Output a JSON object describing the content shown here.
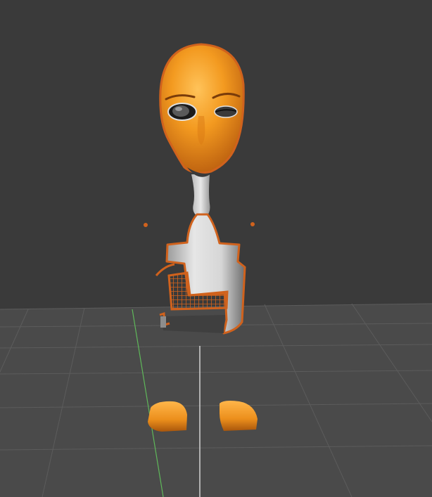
{
  "viewport": {
    "view": "3D viewport",
    "background_color": "#3a3a3a",
    "grid": true,
    "grid_color": "#5a5a5a",
    "axes": {
      "y_axis_color": "#5fb85a",
      "z_axis_color": "#dcdcdc"
    }
  },
  "model": {
    "selected": true,
    "selection_outline_color": "#d0621d",
    "parts": {
      "head": {
        "material_color": "#f0941f"
      },
      "eyes": {
        "left": "open",
        "right": "closed"
      },
      "neck": {
        "material_color": "#c8c8c8"
      },
      "torso": {
        "material_color": "#c8c8c8"
      },
      "mesh_fragment": {
        "color": "#d0621d"
      },
      "shoes": {
        "material_color": "#f0941f",
        "count": 2
      },
      "hand_markers": {
        "count": 2
      }
    }
  }
}
